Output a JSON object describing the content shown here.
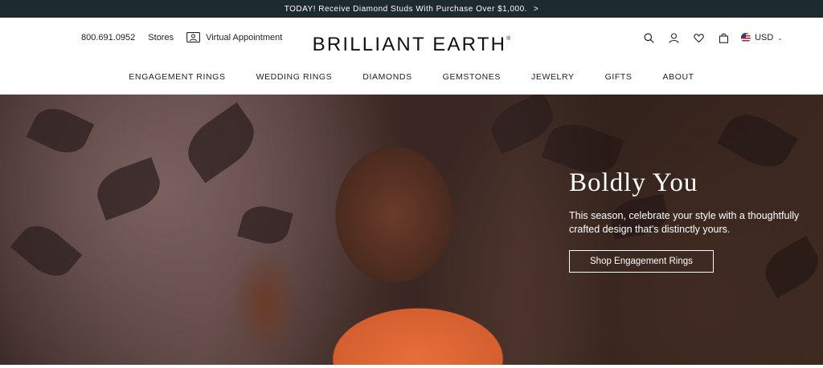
{
  "promo": {
    "text": "TODAY! Receive Diamond Studs With Purchase Over $1,000.",
    "chevron": ">"
  },
  "header": {
    "phone": "800.691.0952",
    "stores": "Stores",
    "virtual_appointment": "Virtual Appointment",
    "logo": "BRILLIANT EARTH",
    "logo_mark": "®",
    "currency": "USD",
    "icons": [
      "search-icon",
      "account-icon",
      "heart-icon",
      "bag-icon"
    ]
  },
  "nav": {
    "items": [
      "ENGAGEMENT RINGS",
      "WEDDING RINGS",
      "DIAMONDS",
      "GEMSTONES",
      "JEWELRY",
      "GIFTS",
      "ABOUT"
    ]
  },
  "hero": {
    "title": "Boldly You",
    "subtitle": "This season, celebrate your style with a thoughtfully crafted design that's distinctly yours.",
    "cta": "Shop Engagement Rings"
  },
  "colors": {
    "promo_bg": "#1d2a2f",
    "text": "#1b1b1b",
    "hero_text": "#ffffff"
  }
}
